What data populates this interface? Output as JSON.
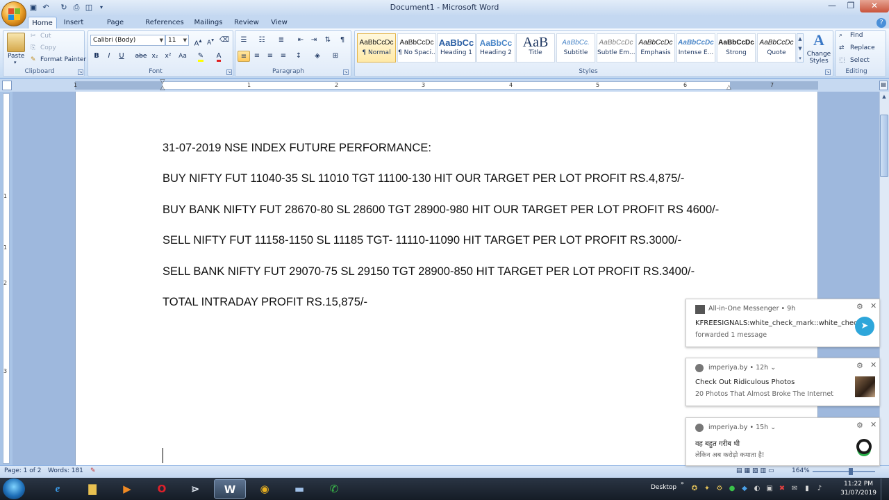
{
  "window": {
    "title": "Document1 - Microsoft Word",
    "controls": [
      "minimize",
      "maximize",
      "close"
    ]
  },
  "tabs": [
    "Home",
    "Insert",
    "Page Layout",
    "References",
    "Mailings",
    "Review",
    "View"
  ],
  "clipboard": {
    "paste": "Paste",
    "cut": "Cut",
    "copy": "Copy",
    "format_painter": "Format Painter",
    "label": "Clipboard"
  },
  "font": {
    "name": "Calibri (Body)",
    "size": "11",
    "label": "Font",
    "buttons": [
      "B",
      "I",
      "U",
      "abe",
      "x₂",
      "x²",
      "Aa"
    ]
  },
  "paragraph": {
    "label": "Paragraph"
  },
  "styles": {
    "label": "Styles",
    "items": [
      {
        "sample": "AaBbCcDc",
        "name": "¶ Normal"
      },
      {
        "sample": "AaBbCcDc",
        "name": "¶ No Spaci..."
      },
      {
        "sample": "AaBbCc",
        "name": "Heading 1"
      },
      {
        "sample": "AaBbCc",
        "name": "Heading 2"
      },
      {
        "sample": "AaB",
        "name": "Title"
      },
      {
        "sample": "AaBbCc.",
        "name": "Subtitle"
      },
      {
        "sample": "AaBbCcDc",
        "name": "Subtle Em..."
      },
      {
        "sample": "AaBbCcDc",
        "name": "Emphasis"
      },
      {
        "sample": "AaBbCcDc",
        "name": "Intense E..."
      },
      {
        "sample": "AaBbCcDc",
        "name": "Strong"
      },
      {
        "sample": "AaBbCcDc",
        "name": "Quote"
      }
    ],
    "change_styles": "Change Styles"
  },
  "editing": {
    "label": "Editing",
    "find": "Find",
    "replace": "Replace",
    "select": "Select"
  },
  "ruler_numbers": [
    "1",
    "1",
    "2",
    "3",
    "4",
    "5",
    "6",
    "7"
  ],
  "vruler_numbers": [
    "1",
    "1",
    "2",
    "3"
  ],
  "document": {
    "lines": [
      "31-07-2019 NSE INDEX FUTURE PERFORMANCE:",
      "BUY NIFTY FUT 11040-35 SL 11010 TGT 11100-130 HIT OUR TARGET PER LOT PROFIT RS.4,875/-",
      "BUY BANK NIFTY FUT 28670-80 SL 28600 TGT 28900-980 HIT OUR TARGET PER LOT PROFIT RS 4600/-",
      "SELL NIFTY FUT 11158-1150 SL 11185 TGT- 11110-11090 HIT TARGET PER LOT PROFIT RS.3000/-",
      "SELL BANK NIFTY FUT 29070-75 SL 29150 TGT 28900-850 HIT TARGET PER LOT PROFIT RS.3400/-",
      "TOTAL INTRADAY PROFIT RS.15,875/-"
    ]
  },
  "statusbar": {
    "page": "Page: 1 of 2",
    "words": "Words: 181",
    "zoom": "164%"
  },
  "taskbar": {
    "desktop": "Desktop",
    "time": "11:22 PM",
    "date": "31/07/2019"
  },
  "notifications": [
    {
      "app": "All-in-One Messenger",
      "age": "• 9h",
      "title": "KFREESIGNALS:white_check_mark::white_check...",
      "body": "forwarded 1 message"
    },
    {
      "app": "imperiya.by",
      "age": "• 12h ⌄",
      "title": "Check Out Ridiculous Photos",
      "body": "20 Photos That Almost Broke The Internet"
    },
    {
      "app": "imperiya.by",
      "age": "• 15h ⌄",
      "title": "वह बहुत गरीब थी",
      "body": "लेकिन अब करोड़ो कमाता है!"
    }
  ],
  "colors": {
    "ribbon_bg": "#d9e7f8",
    "accent": "#ffc95a",
    "telegram": "#2ea6da",
    "taskbar": "#151c26"
  }
}
